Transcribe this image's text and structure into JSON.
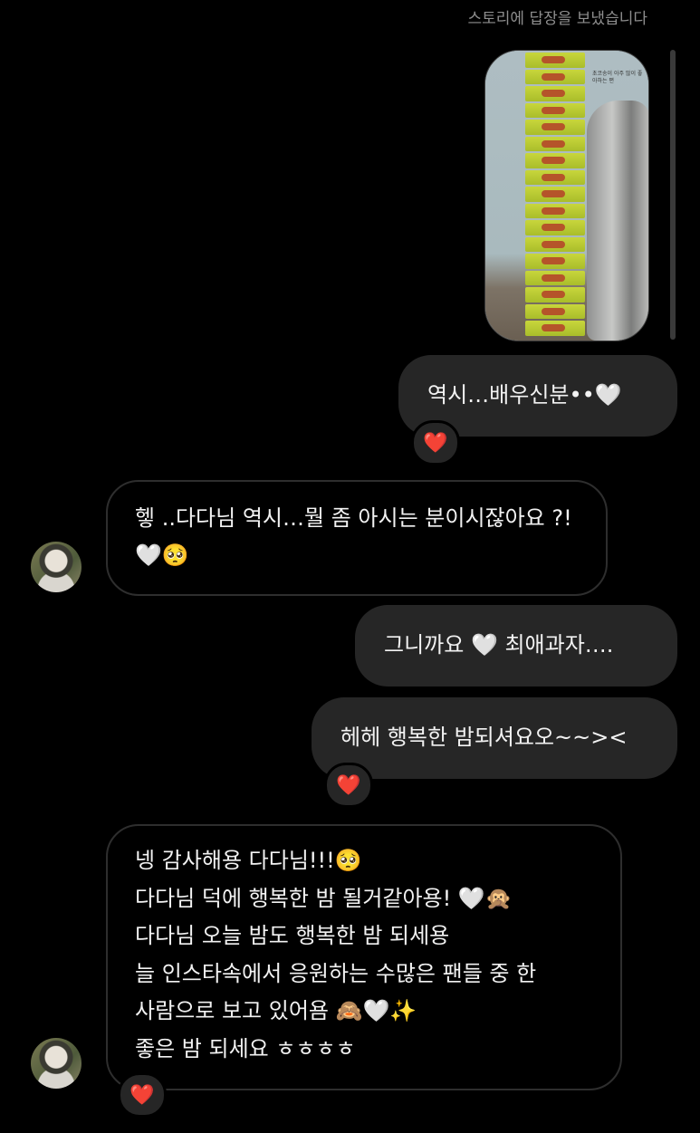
{
  "conversation": {
    "status_text": "스토리에 답장을 보냈습니다",
    "story_reply": {
      "caption": "초코송이 아주 많이 좋아하는 편"
    },
    "messages": [
      {
        "side": "sent",
        "text": "역시…배우신분••🤍",
        "reaction": "❤️"
      },
      {
        "side": "received",
        "text": "헿  ..다다님 역시…뭘 좀 아시는 분이시잖아요 ?!🤍🥺"
      },
      {
        "side": "sent",
        "text": "그니까요 🤍 최애과자…."
      },
      {
        "side": "sent",
        "text": "헤헤 행복한 밤되셔요오~~><",
        "reaction": "❤️"
      },
      {
        "side": "received",
        "lines": [
          "넹 감사해용 다다님!!!🥺",
          "다다님 덕에 행복한 밤 될거같아용! 🤍🙊",
          "다다님 오늘 밤도 행복한 밤 되세용",
          "늘 인스타속에서 응원하는 수많은 팬들 중 한",
          "사람으로 보고 있어욤 🙈🤍✨",
          "좋은 밤 되세요 ㅎㅎㅎㅎ"
        ],
        "reaction": "❤️"
      }
    ]
  },
  "colors": {
    "background": "#000000",
    "sent_bubble": "#262626",
    "reaction_heart": "#ed4956"
  }
}
